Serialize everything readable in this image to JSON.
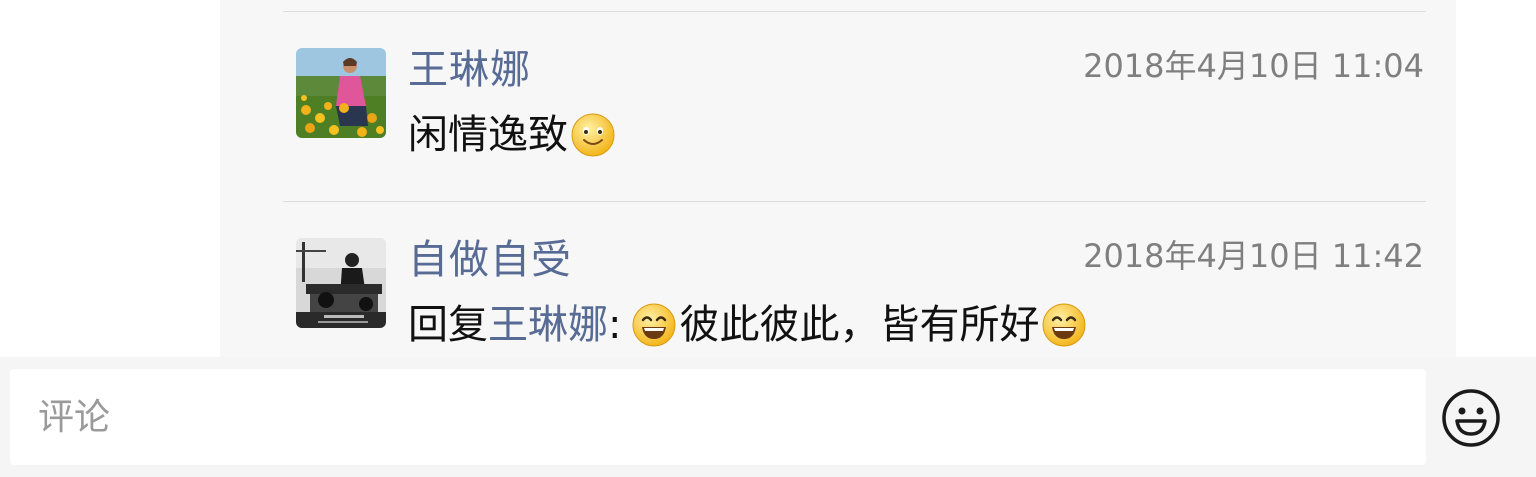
{
  "comments": [
    {
      "author": "王琳娜",
      "timestamp": "2018年4月10日 11:04",
      "text": "闲情逸致",
      "trailing_emoji": "smile-icon"
    },
    {
      "author": "自做自受",
      "timestamp": "2018年4月10日 11:42",
      "reply_prefix": "回复",
      "reply_to": "王琳娜",
      "reply_colon": ":",
      "text": "彼此彼此，皆有所好",
      "leading_emoji": "grin-icon",
      "trailing_emoji": "grin-icon"
    }
  ],
  "input": {
    "placeholder": "评论",
    "value": ""
  },
  "emoji_button": {
    "icon": "smiley-outline-icon"
  },
  "colors": {
    "link": "#576b95",
    "text": "#111111",
    "timestamp": "#7f7f7f",
    "panel_bg": "#f7f7f7"
  }
}
